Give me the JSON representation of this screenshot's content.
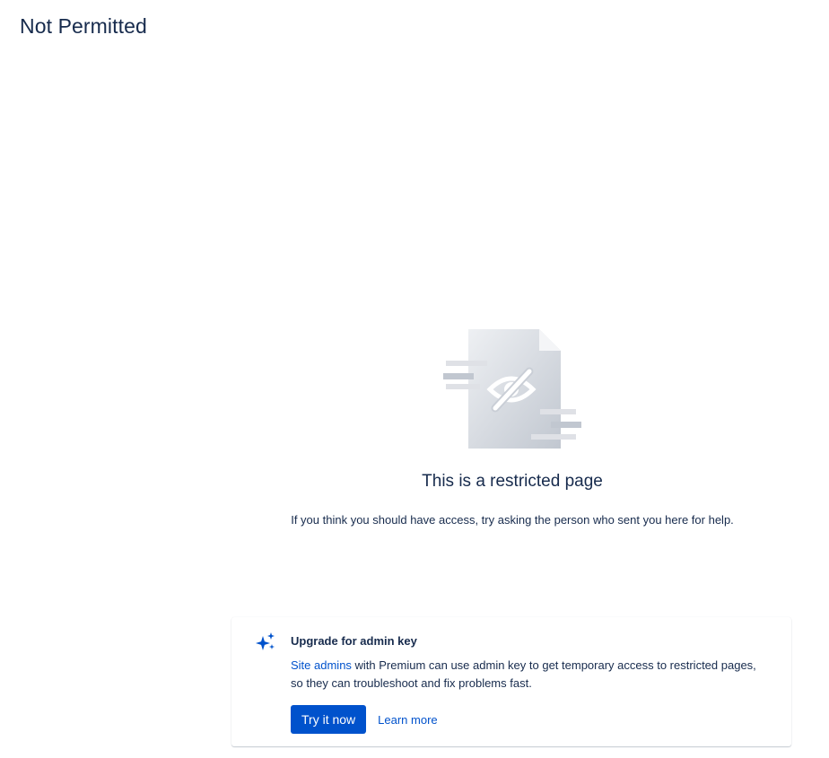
{
  "page": {
    "title": "Not Permitted"
  },
  "restricted": {
    "illustration": "restricted-document-eye-slash-icon",
    "heading": "This is a restricted page",
    "description": "If you think you should have access, try asking the person who sent you here for help."
  },
  "upgrade_card": {
    "icon": "sparkle-icon",
    "title": "Upgrade for admin key",
    "body_link": "Site admins",
    "body_text": " with Premium can use admin key to get temporary access to restricted pages, so they can troubleshoot and fix problems fast.",
    "primary_button": "Try it now",
    "secondary_link": "Learn more"
  },
  "colors": {
    "text": "#172b4d",
    "brand": "#0052cc",
    "illustration_gray": "#c1c7d0"
  }
}
